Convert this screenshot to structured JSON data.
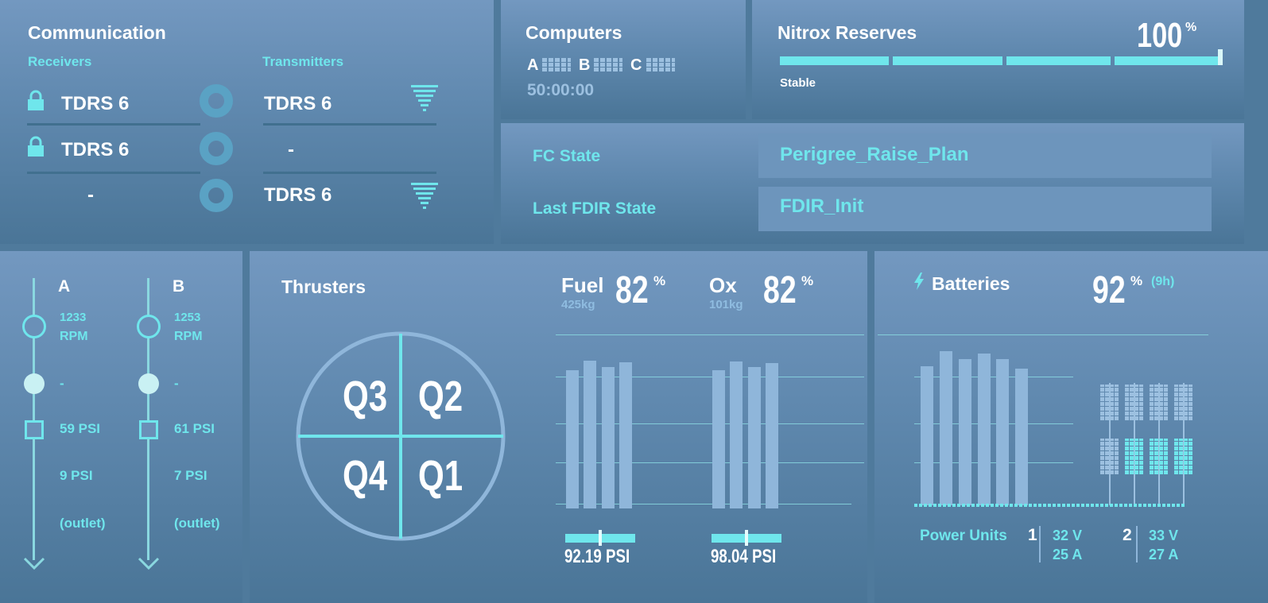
{
  "communication": {
    "title": "Communication",
    "receivers_label": "Receivers",
    "transmitters_label": "Transmitters",
    "receivers": [
      "TDRS 6",
      "TDRS 6",
      "-"
    ],
    "transmitters": [
      "TDRS 6",
      "-",
      "TDRS 6"
    ]
  },
  "computers": {
    "title": "Computers",
    "units": [
      "A",
      "B",
      "C"
    ],
    "timer": "50:00:00"
  },
  "nitrox": {
    "title": "Nitrox Reserves",
    "value": "100",
    "unit": "%",
    "status": "Stable",
    "level": 1.0
  },
  "fc": {
    "fc_state_label": "FC State",
    "fc_state_value": "Perigree_Raise_Plan",
    "fdir_label": "Last FDIR State",
    "fdir_value": "FDIR_Init"
  },
  "pumps": [
    {
      "label": "A",
      "rpm": "1233",
      "rpm_unit": "RPM",
      "dash": "-",
      "psi1": "59 PSI",
      "psi2": "9 PSI",
      "outlet": "(outlet)"
    },
    {
      "label": "B",
      "rpm": "1253",
      "rpm_unit": "RPM",
      "dash": "-",
      "psi1": "61 PSI",
      "psi2": "7 PSI",
      "outlet": "(outlet)"
    }
  ],
  "thrusters": {
    "title": "Thrusters",
    "quadrants": [
      "Q3",
      "Q2",
      "Q4",
      "Q1"
    ],
    "fuel": {
      "label": "Fuel",
      "mass": "425kg",
      "value": "82",
      "unit": "%",
      "pressure": "92.19 PSI",
      "pressure_level": 0.55
    },
    "ox": {
      "label": "Ox",
      "mass": "101kg",
      "value": "82",
      "unit": "%",
      "pressure": "98.04 PSI",
      "pressure_level": 0.5
    }
  },
  "batteries": {
    "title": "Batteries",
    "value": "92",
    "unit": "%",
    "duration": "(9h)",
    "power_units_label": "Power Units",
    "units": [
      {
        "id": "1",
        "voltage": "32 V",
        "current": "25 A"
      },
      {
        "id": "2",
        "voltage": "33 V",
        "current": "27 A"
      }
    ]
  },
  "colors": {
    "accent": "#6fe6ec",
    "panel": "#6a90b8",
    "bar": "#8fb6da"
  },
  "icons": [
    "lock-icon",
    "ring-icon",
    "signal-icon",
    "bolt-icon",
    "circle-icon",
    "square-icon",
    "arrow-down-icon"
  ]
}
